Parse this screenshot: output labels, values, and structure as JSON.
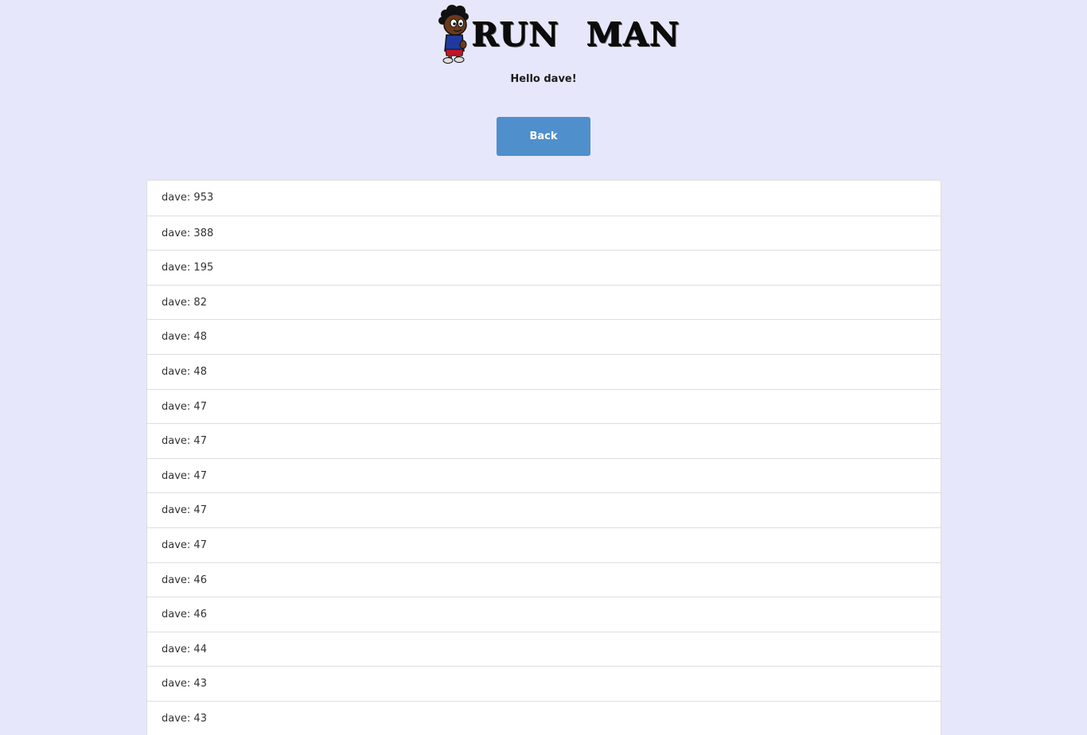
{
  "header": {
    "logo_text_1": "RUN",
    "logo_text_2": "MAN",
    "logo_icon": "runner-character-icon"
  },
  "greeting": "Hello dave!",
  "back_button_label": "Back",
  "scores": [
    "dave: 953",
    "dave: 388",
    "dave: 195",
    "dave: 82",
    "dave: 48",
    "dave: 48",
    "dave: 47",
    "dave: 47",
    "dave: 47",
    "dave: 47",
    "dave: 47",
    "dave: 46",
    "dave: 46",
    "dave: 44",
    "dave: 43",
    "dave: 43"
  ],
  "colors": {
    "background": "#e7e7fb",
    "button": "#4f8fcb",
    "list_background": "#ffffff"
  }
}
